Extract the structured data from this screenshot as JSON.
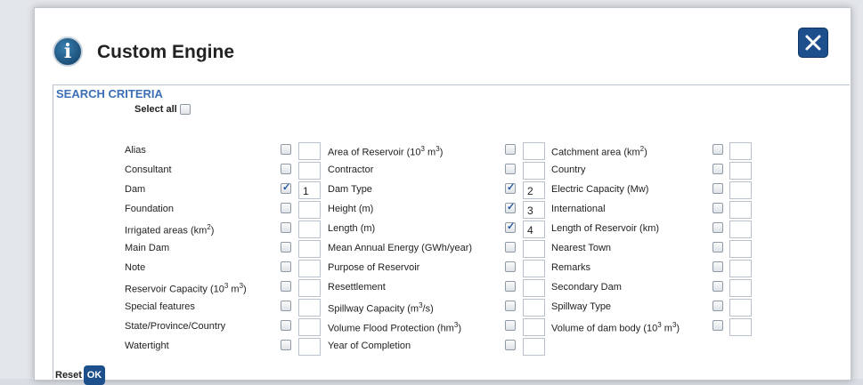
{
  "modal": {
    "title": "Custom Engine",
    "section_title": "SEARCH CRITERIA",
    "select_all_label": "Select all",
    "reset_label": "Reset",
    "ok_label": "OK"
  },
  "rows": [
    [
      {
        "label": "Alias",
        "checked": false,
        "order": ""
      },
      {
        "label": "Area of Reservoir (10<sup>3</sup> m<sup>3</sup>)",
        "checked": false,
        "order": ""
      },
      {
        "label": "Catchment area (km<sup>2</sup>)",
        "checked": false,
        "order": ""
      }
    ],
    [
      {
        "label": "Consultant",
        "checked": false,
        "order": ""
      },
      {
        "label": "Contractor",
        "checked": false,
        "order": ""
      },
      {
        "label": "Country",
        "checked": false,
        "order": ""
      }
    ],
    [
      {
        "label": "Dam",
        "checked": true,
        "order": "1"
      },
      {
        "label": "Dam Type",
        "checked": true,
        "order": "2"
      },
      {
        "label": "Electric Capacity (Mw)",
        "checked": false,
        "order": ""
      }
    ],
    [
      {
        "label": "Foundation",
        "checked": false,
        "order": ""
      },
      {
        "label": "Height (m)",
        "checked": true,
        "order": "3"
      },
      {
        "label": "International",
        "checked": false,
        "order": ""
      }
    ],
    [
      {
        "label": "Irrigated areas (km<sup>2</sup>)",
        "checked": false,
        "order": ""
      },
      {
        "label": "Length (m)",
        "checked": true,
        "order": "4"
      },
      {
        "label": "Length of Reservoir (km)",
        "checked": false,
        "order": ""
      }
    ],
    [
      {
        "label": "Main Dam",
        "checked": false,
        "order": ""
      },
      {
        "label": "Mean Annual Energy (GWh/year)",
        "checked": false,
        "order": ""
      },
      {
        "label": "Nearest Town",
        "checked": false,
        "order": ""
      }
    ],
    [
      {
        "label": "Note",
        "checked": false,
        "order": ""
      },
      {
        "label": "Purpose of Reservoir",
        "checked": false,
        "order": ""
      },
      {
        "label": "Remarks",
        "checked": false,
        "order": ""
      }
    ],
    [
      {
        "label": "Reservoir Capacity (10<sup>3</sup> m<sup>3</sup>)",
        "checked": false,
        "order": ""
      },
      {
        "label": "Resettlement",
        "checked": false,
        "order": ""
      },
      {
        "label": "Secondary Dam",
        "checked": false,
        "order": ""
      }
    ],
    [
      {
        "label": "Special features",
        "checked": false,
        "order": ""
      },
      {
        "label": "Spillway Capacity (m<sup>3</sup>/s)",
        "checked": false,
        "order": ""
      },
      {
        "label": "Spillway Type",
        "checked": false,
        "order": ""
      }
    ],
    [
      {
        "label": "State/Province/Country",
        "checked": false,
        "order": ""
      },
      {
        "label": "Volume Flood Protection (hm<sup>3</sup>)",
        "checked": false,
        "order": ""
      },
      {
        "label": "Volume of dam body (10<sup>3</sup> m<sup>3</sup>)",
        "checked": false,
        "order": ""
      }
    ],
    [
      {
        "label": "Watertight",
        "checked": false,
        "order": ""
      },
      {
        "label": "Year of Completion",
        "checked": false,
        "order": ""
      },
      null
    ]
  ],
  "colors": {
    "accent": "#1d4f8c",
    "section_title": "#3b6fb6"
  },
  "icons": {
    "info": "info-icon",
    "close": "close-icon"
  }
}
